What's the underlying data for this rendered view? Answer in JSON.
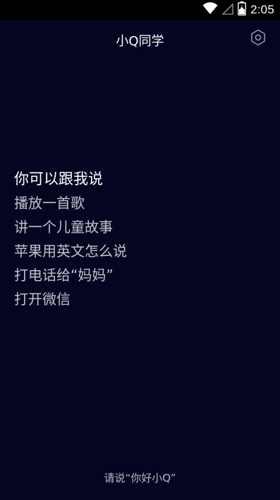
{
  "status_bar": {
    "time": "2:05",
    "icons": [
      "wifi-icon",
      "cellular-signal-icon",
      "battery-charging-icon"
    ]
  },
  "header": {
    "title": "小Q同学",
    "settings_icon": "gear-icon"
  },
  "suggestions": {
    "heading": "你可以跟我说",
    "items": [
      "播放一首歌",
      "讲一个儿童故事",
      "苹果用英文怎么说",
      "打电话给“妈妈”",
      "打开微信"
    ]
  },
  "bottom_hint": "请说“你好小Q”",
  "colors": {
    "background": "#050521",
    "status_bar": "#000000",
    "text_primary": "#ffffff",
    "text_secondary": "#c2c2cc"
  }
}
